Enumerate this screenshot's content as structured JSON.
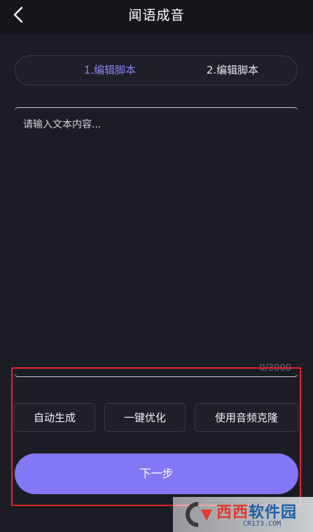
{
  "header": {
    "title": "闻语成音",
    "back_icon": "chevron-left-icon"
  },
  "tabs": [
    {
      "label": "1.编辑脚本",
      "active": true
    },
    {
      "label": "2.编辑脚本",
      "active": false
    }
  ],
  "editor": {
    "placeholder": "请输入文本内容...",
    "counter": "0/3000"
  },
  "actions": {
    "auto_generate": "自动生成",
    "one_click_optimize": "一键优化",
    "use_audio_clone": "使用音频克隆"
  },
  "next_button": "下一步",
  "watermark": {
    "logo_part1": "西西",
    "logo_part2": "软件园",
    "url": "CR173.COM"
  },
  "colors": {
    "background": "#1c1c25",
    "accent": "#8377f5",
    "active_tab_text": "#8b80f5",
    "highlight": "#e0242b"
  }
}
